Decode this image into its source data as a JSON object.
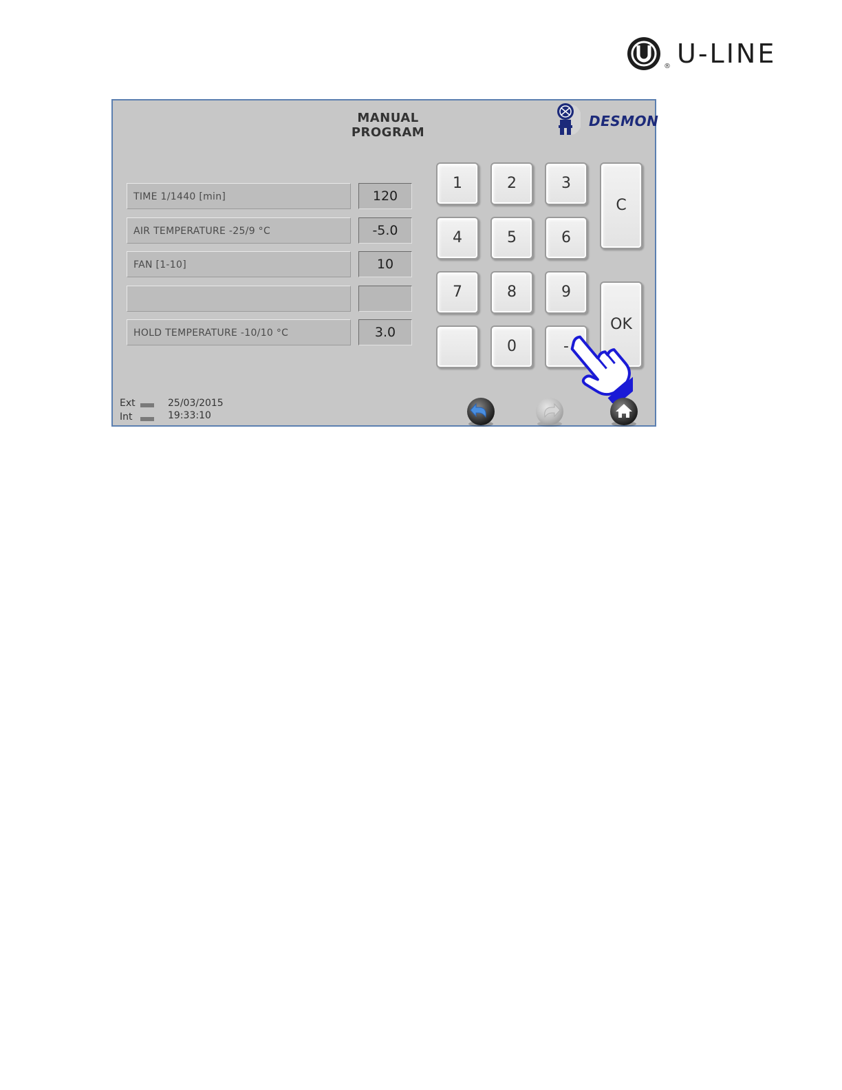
{
  "brand": {
    "name": "U-LINE",
    "registered": "®",
    "colors": {
      "text": "#1e1e1e",
      "mark": "#1e1e1e"
    }
  },
  "screen": {
    "title": "MANUAL PROGRAM",
    "vendor_logo_text": "DESMON",
    "colors": {
      "background": "#c7c7c7",
      "border": "#5b7fb0",
      "vendor": "#1c2a7a",
      "pointer_hand": "#1a1ad6"
    },
    "rows": [
      {
        "label": "TIME 1/1440 [min]",
        "value": "120"
      },
      {
        "label": "AIR TEMPERATURE -25/9 °C",
        "value": "-5.0"
      },
      {
        "label": "FAN [1-10]",
        "value": "10"
      },
      {
        "label": "",
        "value": ""
      },
      {
        "label": "HOLD TEMPERATURE -10/10 °C",
        "value": "3.0"
      }
    ],
    "keypad": {
      "keys": [
        "1",
        "2",
        "3",
        "4",
        "5",
        "6",
        "7",
        "8",
        "9",
        "",
        "0",
        "-"
      ],
      "clear_label": "C",
      "ok_label": "OK"
    },
    "status": {
      "ext_label": "Ext",
      "int_label": "Int",
      "date": "25/03/2015",
      "time": "19:33:10"
    },
    "nav": {
      "back_icon": "back-arrow-icon",
      "forward_icon": "forward-arrow-icon",
      "home_icon": "home-icon"
    }
  }
}
